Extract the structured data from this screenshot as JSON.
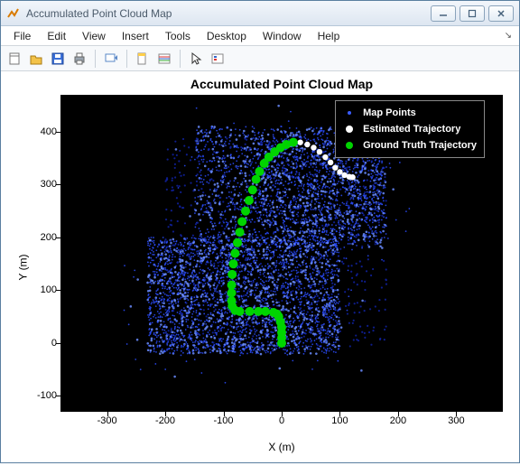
{
  "window": {
    "title": "Accumulated Point Cloud Map"
  },
  "menu": {
    "items": [
      "File",
      "Edit",
      "View",
      "Insert",
      "Tools",
      "Desktop",
      "Window",
      "Help"
    ]
  },
  "toolbar": {
    "icons": [
      "new-figure-icon",
      "open-icon",
      "save-icon",
      "print-icon",
      "sep",
      "link-icon",
      "sep",
      "data-cursor-icon",
      "colorbar-icon",
      "sep",
      "pointer-icon",
      "insert-legend-icon"
    ]
  },
  "chart_data": {
    "type": "scatter",
    "title": "Accumulated Point Cloud Map",
    "xlabel": "X (m)",
    "ylabel": "Y (m)",
    "xlim": [
      -380,
      380
    ],
    "ylim": [
      -130,
      470
    ],
    "xticks": [
      -300,
      -200,
      -100,
      0,
      100,
      200,
      300
    ],
    "yticks": [
      -100,
      0,
      100,
      200,
      300,
      400
    ],
    "background": "#000000",
    "series": [
      {
        "name": "Map Points",
        "color": "#1a3cff",
        "marker": "dot-small",
        "note": "dense accumulated LiDAR point cloud; thousands of points roughly bounded by x∈[-250,200], y∈[-30,400], forming an urban-block shape"
      },
      {
        "name": "Estimated Trajectory",
        "color": "#ffffff",
        "marker": "circle",
        "points": [
          [
            0,
            0
          ],
          [
            0,
            10
          ],
          [
            0,
            20
          ],
          [
            0,
            30
          ],
          [
            -2,
            40
          ],
          [
            -5,
            50
          ],
          [
            -8,
            55
          ],
          [
            -14,
            58
          ],
          [
            -28,
            60
          ],
          [
            -40,
            60
          ],
          [
            -55,
            60
          ],
          [
            -72,
            60
          ],
          [
            -80,
            62
          ],
          [
            -85,
            70
          ],
          [
            -86,
            80
          ],
          [
            -86,
            95
          ],
          [
            -86,
            110
          ],
          [
            -85,
            130
          ],
          [
            -83,
            150
          ],
          [
            -80,
            170
          ],
          [
            -76,
            190
          ],
          [
            -72,
            210
          ],
          [
            -68,
            230
          ],
          [
            -62,
            250
          ],
          [
            -56,
            270
          ],
          [
            -50,
            290
          ],
          [
            -44,
            310
          ],
          [
            -38,
            325
          ],
          [
            -30,
            340
          ],
          [
            -22,
            352
          ],
          [
            -12,
            362
          ],
          [
            -2,
            370
          ],
          [
            8,
            376
          ],
          [
            20,
            380
          ],
          [
            32,
            380
          ],
          [
            44,
            376
          ],
          [
            55,
            370
          ],
          [
            65,
            362
          ],
          [
            75,
            352
          ],
          [
            84,
            342
          ],
          [
            92,
            332
          ],
          [
            100,
            324
          ],
          [
            108,
            318
          ],
          [
            116,
            315
          ],
          [
            122,
            314
          ]
        ]
      },
      {
        "name": "Ground Truth Trajectory",
        "color": "#00d400",
        "marker": "circle-large",
        "points": [
          [
            0,
            0
          ],
          [
            0,
            10
          ],
          [
            0,
            20
          ],
          [
            0,
            30
          ],
          [
            -2,
            40
          ],
          [
            -5,
            50
          ],
          [
            -8,
            55
          ],
          [
            -14,
            58
          ],
          [
            -28,
            60
          ],
          [
            -40,
            60
          ],
          [
            -55,
            60
          ],
          [
            -72,
            60
          ],
          [
            -80,
            62
          ],
          [
            -85,
            70
          ],
          [
            -86,
            80
          ],
          [
            -86,
            95
          ],
          [
            -86,
            110
          ],
          [
            -85,
            130
          ],
          [
            -83,
            150
          ],
          [
            -80,
            170
          ],
          [
            -76,
            190
          ],
          [
            -72,
            210
          ],
          [
            -68,
            230
          ],
          [
            -62,
            250
          ],
          [
            -56,
            270
          ],
          [
            -50,
            290
          ],
          [
            -44,
            310
          ],
          [
            -38,
            325
          ],
          [
            -30,
            340
          ],
          [
            -22,
            352
          ],
          [
            -12,
            362
          ],
          [
            -2,
            370
          ],
          [
            8,
            376
          ],
          [
            20,
            380
          ]
        ]
      }
    ],
    "legend": {
      "position": "upper-right",
      "entries": [
        "Map Points",
        "Estimated Trajectory",
        "Ground Truth Trajectory"
      ]
    }
  },
  "colors": {
    "map_points": "#2a4cff",
    "map_points_bright": "#6a8cff",
    "estimated": "#ffffff",
    "ground_truth": "#00d400"
  }
}
